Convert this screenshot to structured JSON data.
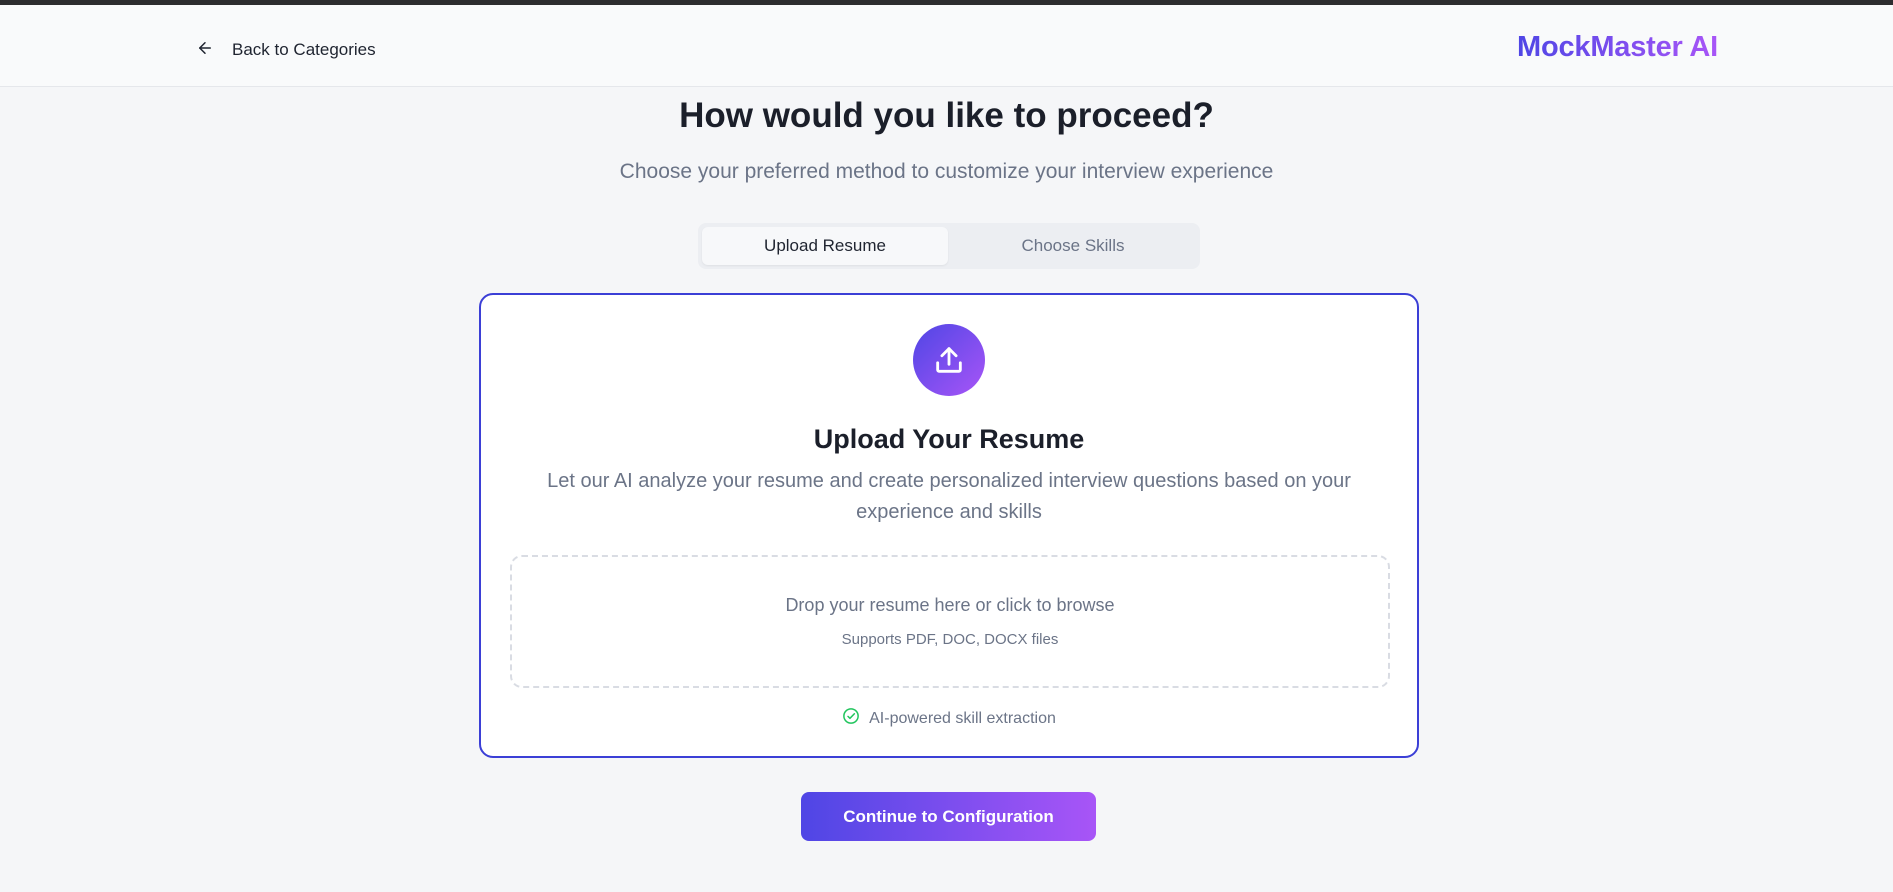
{
  "header": {
    "back_label": "Back to Categories",
    "brand": "MockMaster AI"
  },
  "main": {
    "title": "How would you like to proceed?",
    "subtitle": "Choose your preferred method to customize your interview experience",
    "tabs": [
      {
        "label": "Upload Resume",
        "active": true
      },
      {
        "label": "Choose Skills",
        "active": false
      }
    ]
  },
  "upload_card": {
    "icon": "upload-icon",
    "title": "Upload Your Resume",
    "description": "Let our AI analyze your resume and create personalized interview questions based on your experience and skills",
    "dropzone": {
      "main_text": "Drop your resume here or click to browse",
      "sub_text": "Supports PDF, DOC, DOCX files"
    },
    "feature": {
      "icon": "check-circle-icon",
      "label": "AI-powered skill extraction"
    }
  },
  "actions": {
    "continue_label": "Continue to Configuration"
  },
  "colors": {
    "accent_start": "#4f46e5",
    "accent_end": "#a855f7",
    "card_border": "#3b3fd6",
    "success": "#22c55e"
  }
}
